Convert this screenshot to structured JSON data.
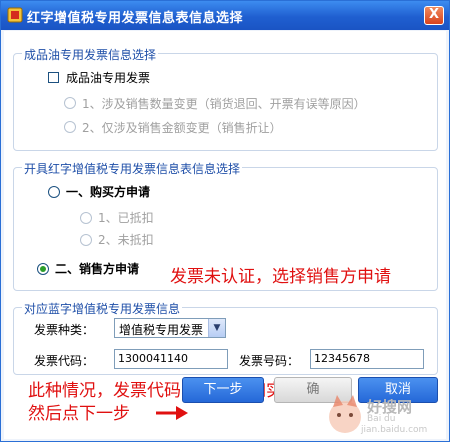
{
  "window": {
    "title": "红字增值税专用发票信息表信息选择",
    "close_glyph": "X"
  },
  "oil_section": {
    "title": "成品油专用发票信息选择",
    "checkbox_label": "成品油专用发票",
    "options": [
      "1、涉及销售数量变更（销货退回、开票有误等原因）",
      "2、仅涉及销售金额变更（销售折让）"
    ]
  },
  "red_section": {
    "title": "开具红字增值税专用发票信息表信息选择",
    "buyer_label": "一、购买方申请",
    "buyer_options": [
      "1、已抵扣",
      "2、未抵扣"
    ],
    "seller_label": "二、销售方申请",
    "selected": "seller"
  },
  "blue_section": {
    "title": "对应蓝字增值税专用发票信息",
    "type_label": "发票种类：",
    "type_value": "增值税专用发票",
    "code_label": "发票代码：",
    "code_value": "1300041140",
    "number_label": "发票号码：",
    "number_value": "12345678"
  },
  "annotations": {
    "note1": "发票未认证，选择销售方申请",
    "note2_line1": "此种情况，发票代码、号码需如实录入，",
    "note2_line2": "然后点下一步"
  },
  "buttons": {
    "next": "下一步",
    "confirm": "确",
    "cancel": "取消"
  },
  "watermark": {
    "text": "好搜网",
    "subtext": "Bai du",
    "url": "jian.baidu.com"
  },
  "colors": {
    "title_bar": "#2566d6",
    "annotation": "#e01010",
    "group_title": "#1f4fa8"
  }
}
